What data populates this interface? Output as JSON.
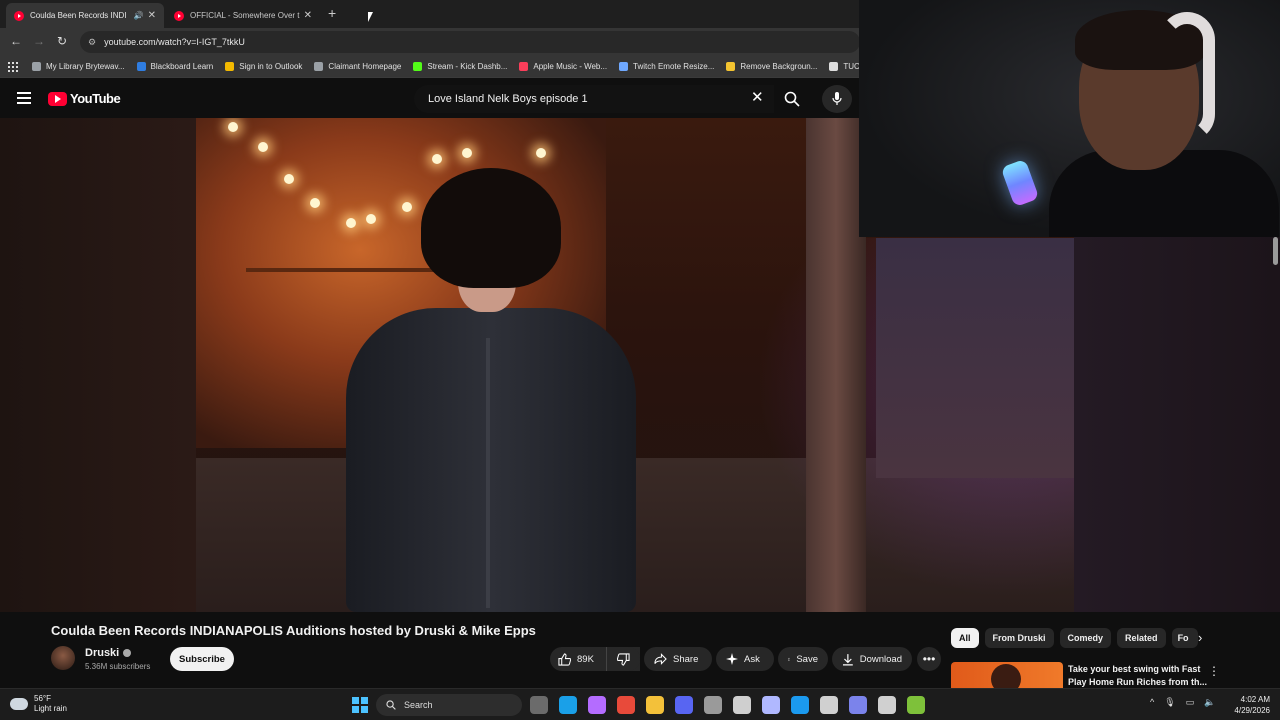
{
  "browser": {
    "tabs": [
      {
        "title": "Coulda Been Records INDI",
        "active": true
      },
      {
        "title": "OFFICIAL - Somewhere Over th",
        "active": false
      }
    ],
    "url": "youtube.com/watch?v=I-IGT_7tkkU",
    "bookmarks": [
      {
        "label": "My Library Brytewav...",
        "color": "#9aa0a6"
      },
      {
        "label": "Blackboard Learn",
        "color": "#2f7de1"
      },
      {
        "label": "Sign in to Outlook",
        "color": "#f3b900"
      },
      {
        "label": "Claimant Homepage",
        "color": "#9aa0a6"
      },
      {
        "label": "Stream - Kick Dashb...",
        "color": "#53fc18"
      },
      {
        "label": "Apple Music - Web...",
        "color": "#fa3e5a"
      },
      {
        "label": "Twitch Emote Resize...",
        "color": "#6fa8ff"
      },
      {
        "label": "Remove Backgroun...",
        "color": "#f4c430"
      },
      {
        "label": "TUCK",
        "color": "#dddddd"
      }
    ]
  },
  "youtube": {
    "logo_text": "YouTube",
    "search_query": "Love Island Nelk Boys episode 1",
    "video": {
      "title": "Coulda Been Records INDIANAPOLIS Auditions hosted by Druski & Mike Epps",
      "channel": "Druski",
      "subscribers": "5.36M subscribers",
      "subscribe_label": "Subscribe",
      "likes": "89K",
      "share_label": "Share",
      "ask_label": "Ask",
      "save_label": "Save",
      "download_label": "Download"
    },
    "chips": [
      "All",
      "From Druski",
      "Comedy",
      "Related",
      "Fo"
    ],
    "recommended": {
      "title": "Take your best swing with Fast Play Home Run Riches from th..."
    }
  },
  "taskbar": {
    "weather_temp": "56°F",
    "weather_desc": "Light rain",
    "search_label": "Search",
    "time": "4:02 AM",
    "date": "4/29/2026",
    "app_icon_colors": [
      "#6b6b6b",
      "#1aa0e8",
      "#b46cff",
      "#e84a3a",
      "#f3c13a",
      "#5865f2",
      "#9a9a9a",
      "#cfcfcf",
      "#b0b8ff",
      "#1b9aef",
      "#d0d0d0",
      "#7b83eb",
      "#d0d0d0",
      "#7ec13a"
    ]
  }
}
